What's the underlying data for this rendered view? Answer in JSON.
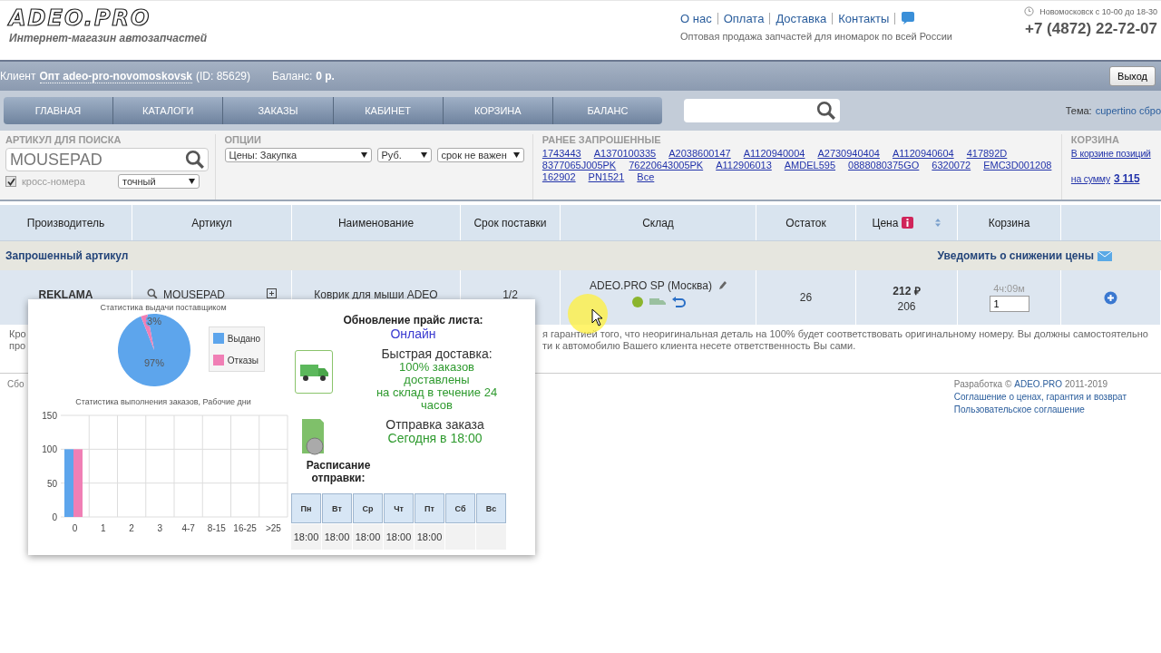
{
  "header": {
    "logo": "ADEO.PRO",
    "tagline": "Интернет-магазин автозапчастей",
    "links": [
      "О нас",
      "Оплата",
      "Доставка",
      "Контакты"
    ],
    "slogan": "Оптовая продажа запчастей для иномарок по всей России",
    "hours": "Новомосковск с 10-00 до 18-30",
    "phone": "+7 (4872) 22-72-07"
  },
  "account_bar": {
    "client_label": "Клиент",
    "client_name": "Опт adeo-pro-novomoskovsk",
    "client_id": "(ID: 85629)",
    "balance_label": "Баланс:",
    "balance": "0 р.",
    "logout": "Выход"
  },
  "nav": {
    "items": [
      "ГЛАВНАЯ",
      "КАТАЛОГИ",
      "ЗАКАЗЫ",
      "КАБИНЕТ",
      "КОРЗИНА",
      "БАЛАНС"
    ],
    "theme_label": "Тема:",
    "theme": "cupertino сбро"
  },
  "search_panel": {
    "article": {
      "title": "АРТИКУЛ ДЛЯ ПОИСКА",
      "value": "MOUSEPAD",
      "cross_label": "кросс-номера",
      "cross_checked": true,
      "mode": "точный"
    },
    "options": {
      "title": "ОПЦИИ",
      "selects": [
        "Цены: Закупка",
        "Руб.",
        "срок не важен"
      ]
    },
    "history": {
      "title": "РАНЕЕ ЗАПРОШЕННЫЕ",
      "links": [
        "1743443",
        "A1370100335",
        "A2038600147",
        "A1120940004",
        "A2730940404",
        "A1120940604",
        "417892D",
        "8377065J005PK",
        "76220643005PK",
        "A112906013",
        "AMDEL595",
        "0888080375GO",
        "6320072",
        "EMC3D001208",
        "162902",
        "PN1521",
        "Все"
      ]
    },
    "cart": {
      "title": "КОРЗИНА",
      "items_text": "В корзине позиций",
      "sum_label": "на сумму",
      "sum": "3 115"
    }
  },
  "table": {
    "columns": [
      "Производитель",
      "Артикул",
      "Наименование",
      "Срок поставки",
      "Склад",
      "Остаток",
      "Цена",
      "Корзина"
    ],
    "group": {
      "label": "Запрошенный артикул",
      "notify": "Уведомить о снижении цены"
    },
    "row": {
      "brand": "REKLAMA",
      "article": "MOUSEPAD",
      "name": "Коврик для мыши ADEO",
      "delivery": "1/2",
      "warehouse": "ADEO.PRO SP (Москва)",
      "stock": "26",
      "price": "212 ₽",
      "price_alt": "206",
      "timer": "4ч:09м",
      "qty": "1"
    }
  },
  "disclaimer": [
    {
      "left": "Кро",
      "right": "я гарантией того, что неоригинальная деталь на 100% будет соответствовать оригинальному номеру. Вы должны самостоятельно"
    },
    {
      "left": "про",
      "right": "ти к автомобилю Вашего клиента несете ответственность Вы сами."
    }
  ],
  "footer": {
    "left": "Сбо",
    "credit_prefix": "Разработка ©",
    "credit_link": "ADEO.PRO",
    "credit_years": "2011-2019",
    "links": [
      "Соглашение о ценах, гарантия и возврат",
      "Пользовательское соглашение"
    ]
  },
  "popup": {
    "pie": {
      "chart_data": {
        "type": "pie",
        "title": "Статистика выдачи поставщиком",
        "categories": [
          "Выдано",
          "Отказы"
        ],
        "values": [
          97,
          3
        ],
        "colors": [
          "#5da5ec",
          "#f07fb5"
        ],
        "value_labels": [
          "97%",
          "3%"
        ]
      }
    },
    "bar": {
      "chart_data": {
        "type": "bar",
        "title": "Статистика выполнения заказов, Рабочие дни",
        "categories": [
          "0",
          "1",
          "2",
          "3",
          "4-7",
          "8-15",
          "16-25",
          ">25"
        ],
        "series": [
          {
            "color": "#5da5ec",
            "values": [
              100,
              0,
              0,
              0,
              0,
              0,
              0,
              0
            ]
          },
          {
            "color": "#f07fb5",
            "values": [
              100,
              0,
              0,
              0,
              0,
              0,
              0,
              0
            ]
          }
        ],
        "ylim": [
          0,
          150
        ],
        "yticks": [
          0,
          50,
          100,
          150
        ]
      }
    },
    "update_label": "Обновление прайс листа:",
    "update_value": "Онлайн",
    "delivery_title": "Быстрая доставка:",
    "delivery_lines": [
      "100% заказов",
      "доставлены",
      "на склад в течение 24",
      "часов"
    ],
    "ship_title": "Отправка заказа",
    "ship_value": "Сегодня в 18:00",
    "schedule_title": "Расписание отправки:",
    "schedule": [
      {
        "day": "Пн",
        "time": "18:00"
      },
      {
        "day": "Вт",
        "time": "18:00"
      },
      {
        "day": "Ср",
        "time": "18:00"
      },
      {
        "day": "Чт",
        "time": "18:00"
      },
      {
        "day": "Пт",
        "time": "18:00"
      },
      {
        "day": "Сб"
      },
      {
        "day": "Вс"
      }
    ]
  }
}
